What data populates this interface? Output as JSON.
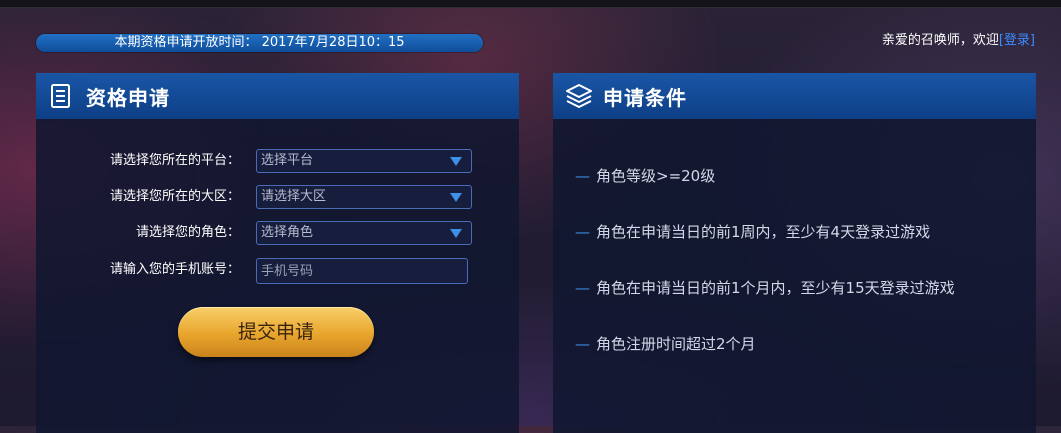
{
  "header": {
    "notice": "本期资格申请开放时间： 2017年7月28日10：15",
    "greeting": "亲爱的召唤师，欢迎",
    "login_link": "[登录]"
  },
  "apply_panel": {
    "title": "资格申请",
    "icon": "document-list-icon",
    "fields": [
      {
        "label": "请选择您所在的平台：",
        "value": "选择平台",
        "type": "select"
      },
      {
        "label": "请选择您所在的大区：",
        "value": "请选择大区",
        "type": "select"
      },
      {
        "label": "请选择您的角色：",
        "value": "选择角色",
        "type": "select"
      },
      {
        "label": "请输入您的手机账号：",
        "placeholder": "手机号码",
        "type": "input"
      }
    ],
    "submit_label": "提交申请"
  },
  "conditions_panel": {
    "title": "申请条件",
    "icon": "layers-icon",
    "dash": "—",
    "items": [
      "角色等级>=20级",
      "角色在申请当日的前1周内，至少有4天登录过游戏",
      "角色在申请当日的前1个月内，至少有15天登录过游戏",
      "角色注册时间超过2个月"
    ]
  },
  "colors": {
    "accent_blue": "#0f4d9a",
    "link_blue": "#3d8bff",
    "button_gold": "#e8a52c"
  }
}
